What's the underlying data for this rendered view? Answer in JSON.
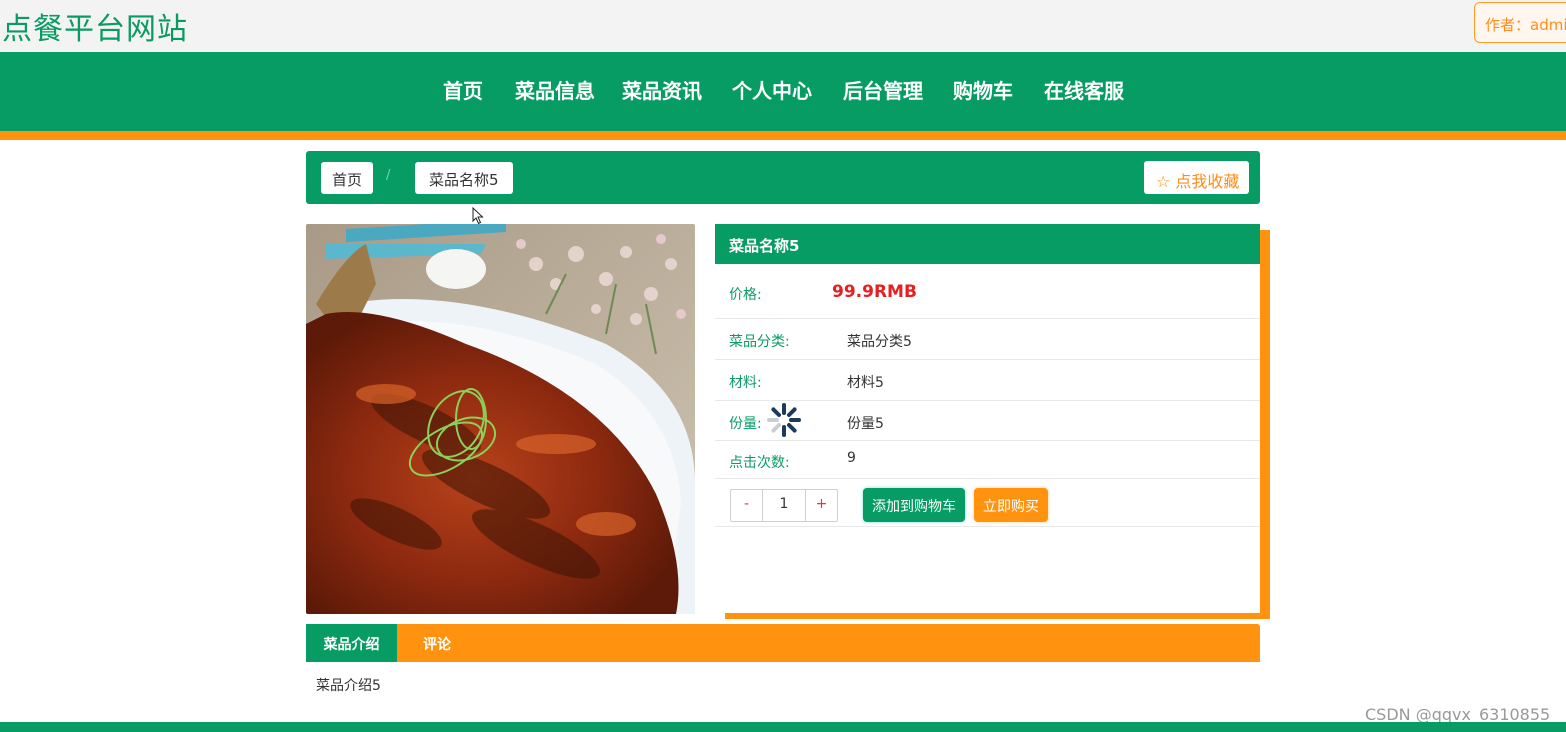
{
  "site": {
    "title": "点餐平台网站",
    "author_badge": "作者：admi"
  },
  "nav": {
    "items": [
      "首页",
      "菜品信息",
      "菜品资讯",
      "个人中心",
      "后台管理",
      "购物车",
      "在线客服"
    ]
  },
  "breadcrumb": {
    "home": "首页",
    "separator": "/",
    "current": "菜品名称5",
    "favorite_label": "☆ 点我收藏"
  },
  "dish": {
    "name": "菜品名称5",
    "price_label": "价格:",
    "price": "99.9RMB",
    "category_label": "菜品分类:",
    "category": "菜品分类5",
    "material_label": "材料:",
    "material": "材料5",
    "portion_label": "份量:",
    "portion": "份量5",
    "clicks_label": "点击次数:",
    "clicks": "9"
  },
  "purchase": {
    "minus": "-",
    "quantity": "1",
    "plus": "+",
    "add_to_cart": "添加到购物车",
    "buy_now": "立即购买"
  },
  "tabs": {
    "intro": "菜品介绍",
    "comments": "评论"
  },
  "intro_text": "菜品介绍5",
  "watermark": "CSDN @qqvx_6310855",
  "colors": {
    "primary": "#079c64",
    "accent": "#ff9310",
    "price": "#e52020"
  }
}
